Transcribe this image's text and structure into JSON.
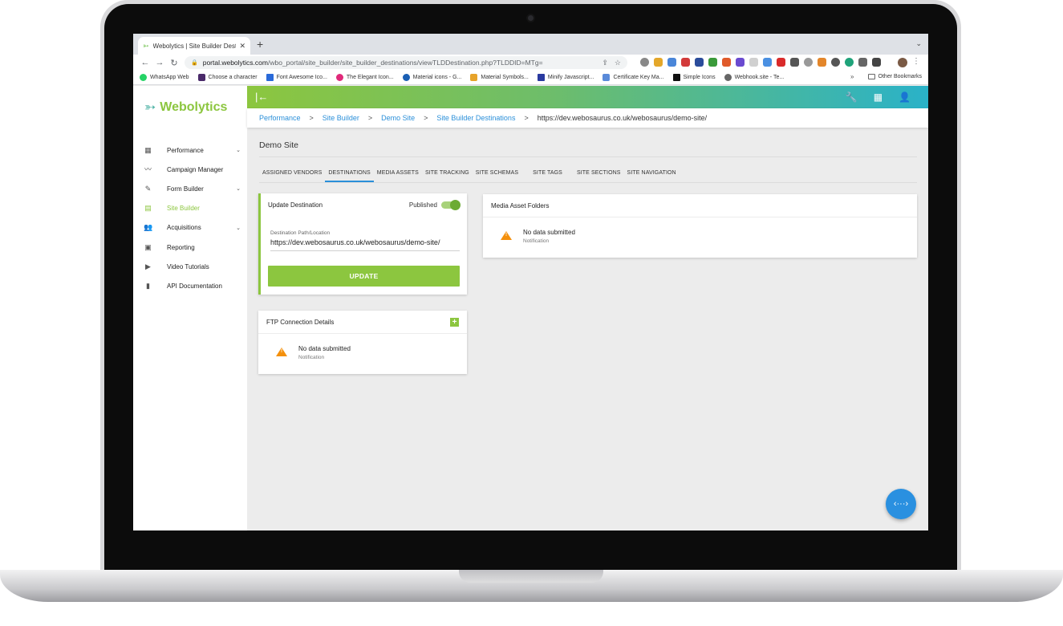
{
  "browser": {
    "tab_title": "Webolytics | Site Builder Destin",
    "url_host": "portal.webolytics.com",
    "url_path": "/wbo_portal/site_builder/site_builder_destinations/viewTLDDestination.php?TLDDID=MTg=",
    "bookmarks": [
      "WhatsApp Web",
      "Choose a character",
      "Font Awesome Ico...",
      "The Elegant Icon...",
      "Material icons - G...",
      "Material Symbols...",
      "Minify Javascript...",
      "Certificate Key Ma...",
      "Simple Icons",
      "Webhook.site - Te..."
    ],
    "other_bookmarks": "Other Bookmarks",
    "more": "»"
  },
  "sidebar": {
    "logo": "Webolytics",
    "items": [
      {
        "label": "Performance",
        "icon": "dashboard-icon",
        "chevron": "⌄"
      },
      {
        "label": "Campaign Manager",
        "icon": "trend-icon",
        "chevron": ""
      },
      {
        "label": "Form Builder",
        "icon": "edit-form-icon",
        "chevron": "⌄"
      },
      {
        "label": "Site Builder",
        "icon": "web-icon",
        "chevron": ""
      },
      {
        "label": "Acquisitions",
        "icon": "people-icon",
        "chevron": "⌄"
      },
      {
        "label": "Reporting",
        "icon": "report-icon",
        "chevron": ""
      },
      {
        "label": "Video Tutorials",
        "icon": "video-icon",
        "chevron": ""
      },
      {
        "label": "API Documentation",
        "icon": "book-icon",
        "chevron": ""
      }
    ]
  },
  "topbar": {
    "collapse_icon": "|←"
  },
  "breadcrumb": {
    "items": [
      "Performance",
      "Site Builder",
      "Demo Site",
      "Site Builder Destinations"
    ],
    "current": "https://dev.webosaurus.co.uk/webosaurus/demo-site/",
    "separator": ">"
  },
  "page": {
    "title": "Demo Site",
    "tabs": [
      "ASSIGNED VENDORS",
      "DESTINATIONS",
      "MEDIA ASSETS",
      "SITE TRACKING",
      "SITE SCHEMAS",
      "SITE TAGS",
      "SITE SECTIONS",
      "SITE NAVIGATION"
    ],
    "active_tab": "DESTINATIONS"
  },
  "update_card": {
    "title": "Update Destination",
    "toggle_label": "Published",
    "published": true,
    "field_label": "Destination Path/Location",
    "field_value": "https://dev.webosaurus.co.uk/webosaurus/demo-site/",
    "button": "UPDATE"
  },
  "ftp_card": {
    "title": "FTP Connection Details",
    "add": "+",
    "empty_title": "No data submitted",
    "empty_sub": "Notification"
  },
  "media_card": {
    "title": "Media Asset Folders",
    "empty_title": "No data submitted",
    "empty_sub": "Notification"
  },
  "fab": {
    "label": "‹···›"
  },
  "colors": {
    "brand_green": "#8cc63f",
    "accent_blue": "#2a8fd9",
    "warning": "#f4900c"
  }
}
